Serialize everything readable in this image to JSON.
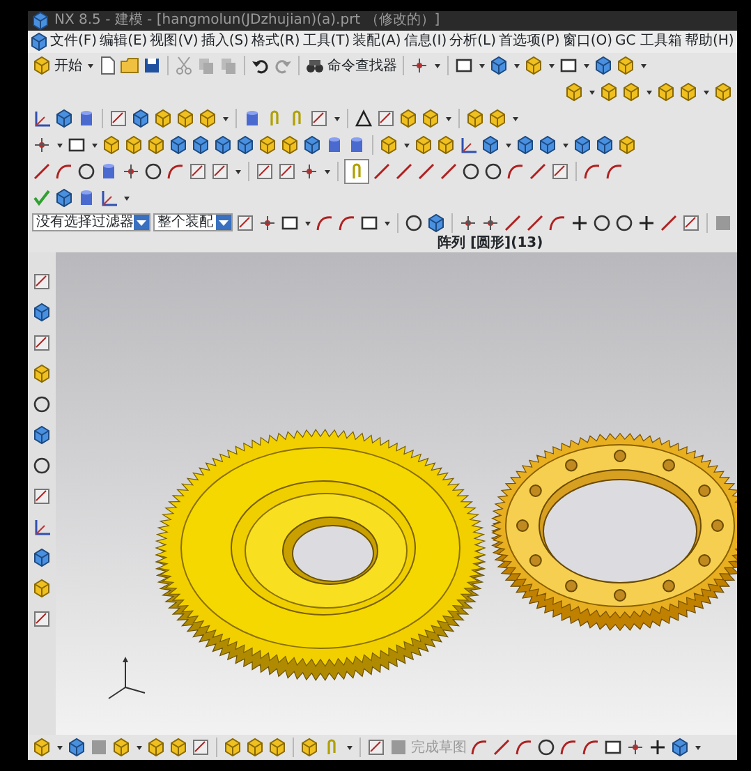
{
  "window": {
    "title": "NX 8.5 - 建模 - [hangmolun(JDzhujian)(a).prt （修改的）]"
  },
  "menu": [
    "文件(F)",
    "编辑(E)",
    "视图(V)",
    "插入(S)",
    "格式(R)",
    "工具(T)",
    "装配(A)",
    "信息(I)",
    "分析(L)",
    "首选项(P)",
    "窗口(O)",
    "GC 工具箱",
    "帮助(H)"
  ],
  "toolbar": {
    "start_button": "开始",
    "command_finder": "命令查找器",
    "associative_toggle": {
      "on": true
    }
  },
  "selection_bar": {
    "filter": {
      "value": "没有选择过滤器"
    },
    "scope": {
      "value": "整个装配"
    }
  },
  "status": "阵列 [圆形](13)",
  "bottom_toolbar": {
    "finish_sketch": {
      "label": "完成草图",
      "disabled": true
    }
  }
}
